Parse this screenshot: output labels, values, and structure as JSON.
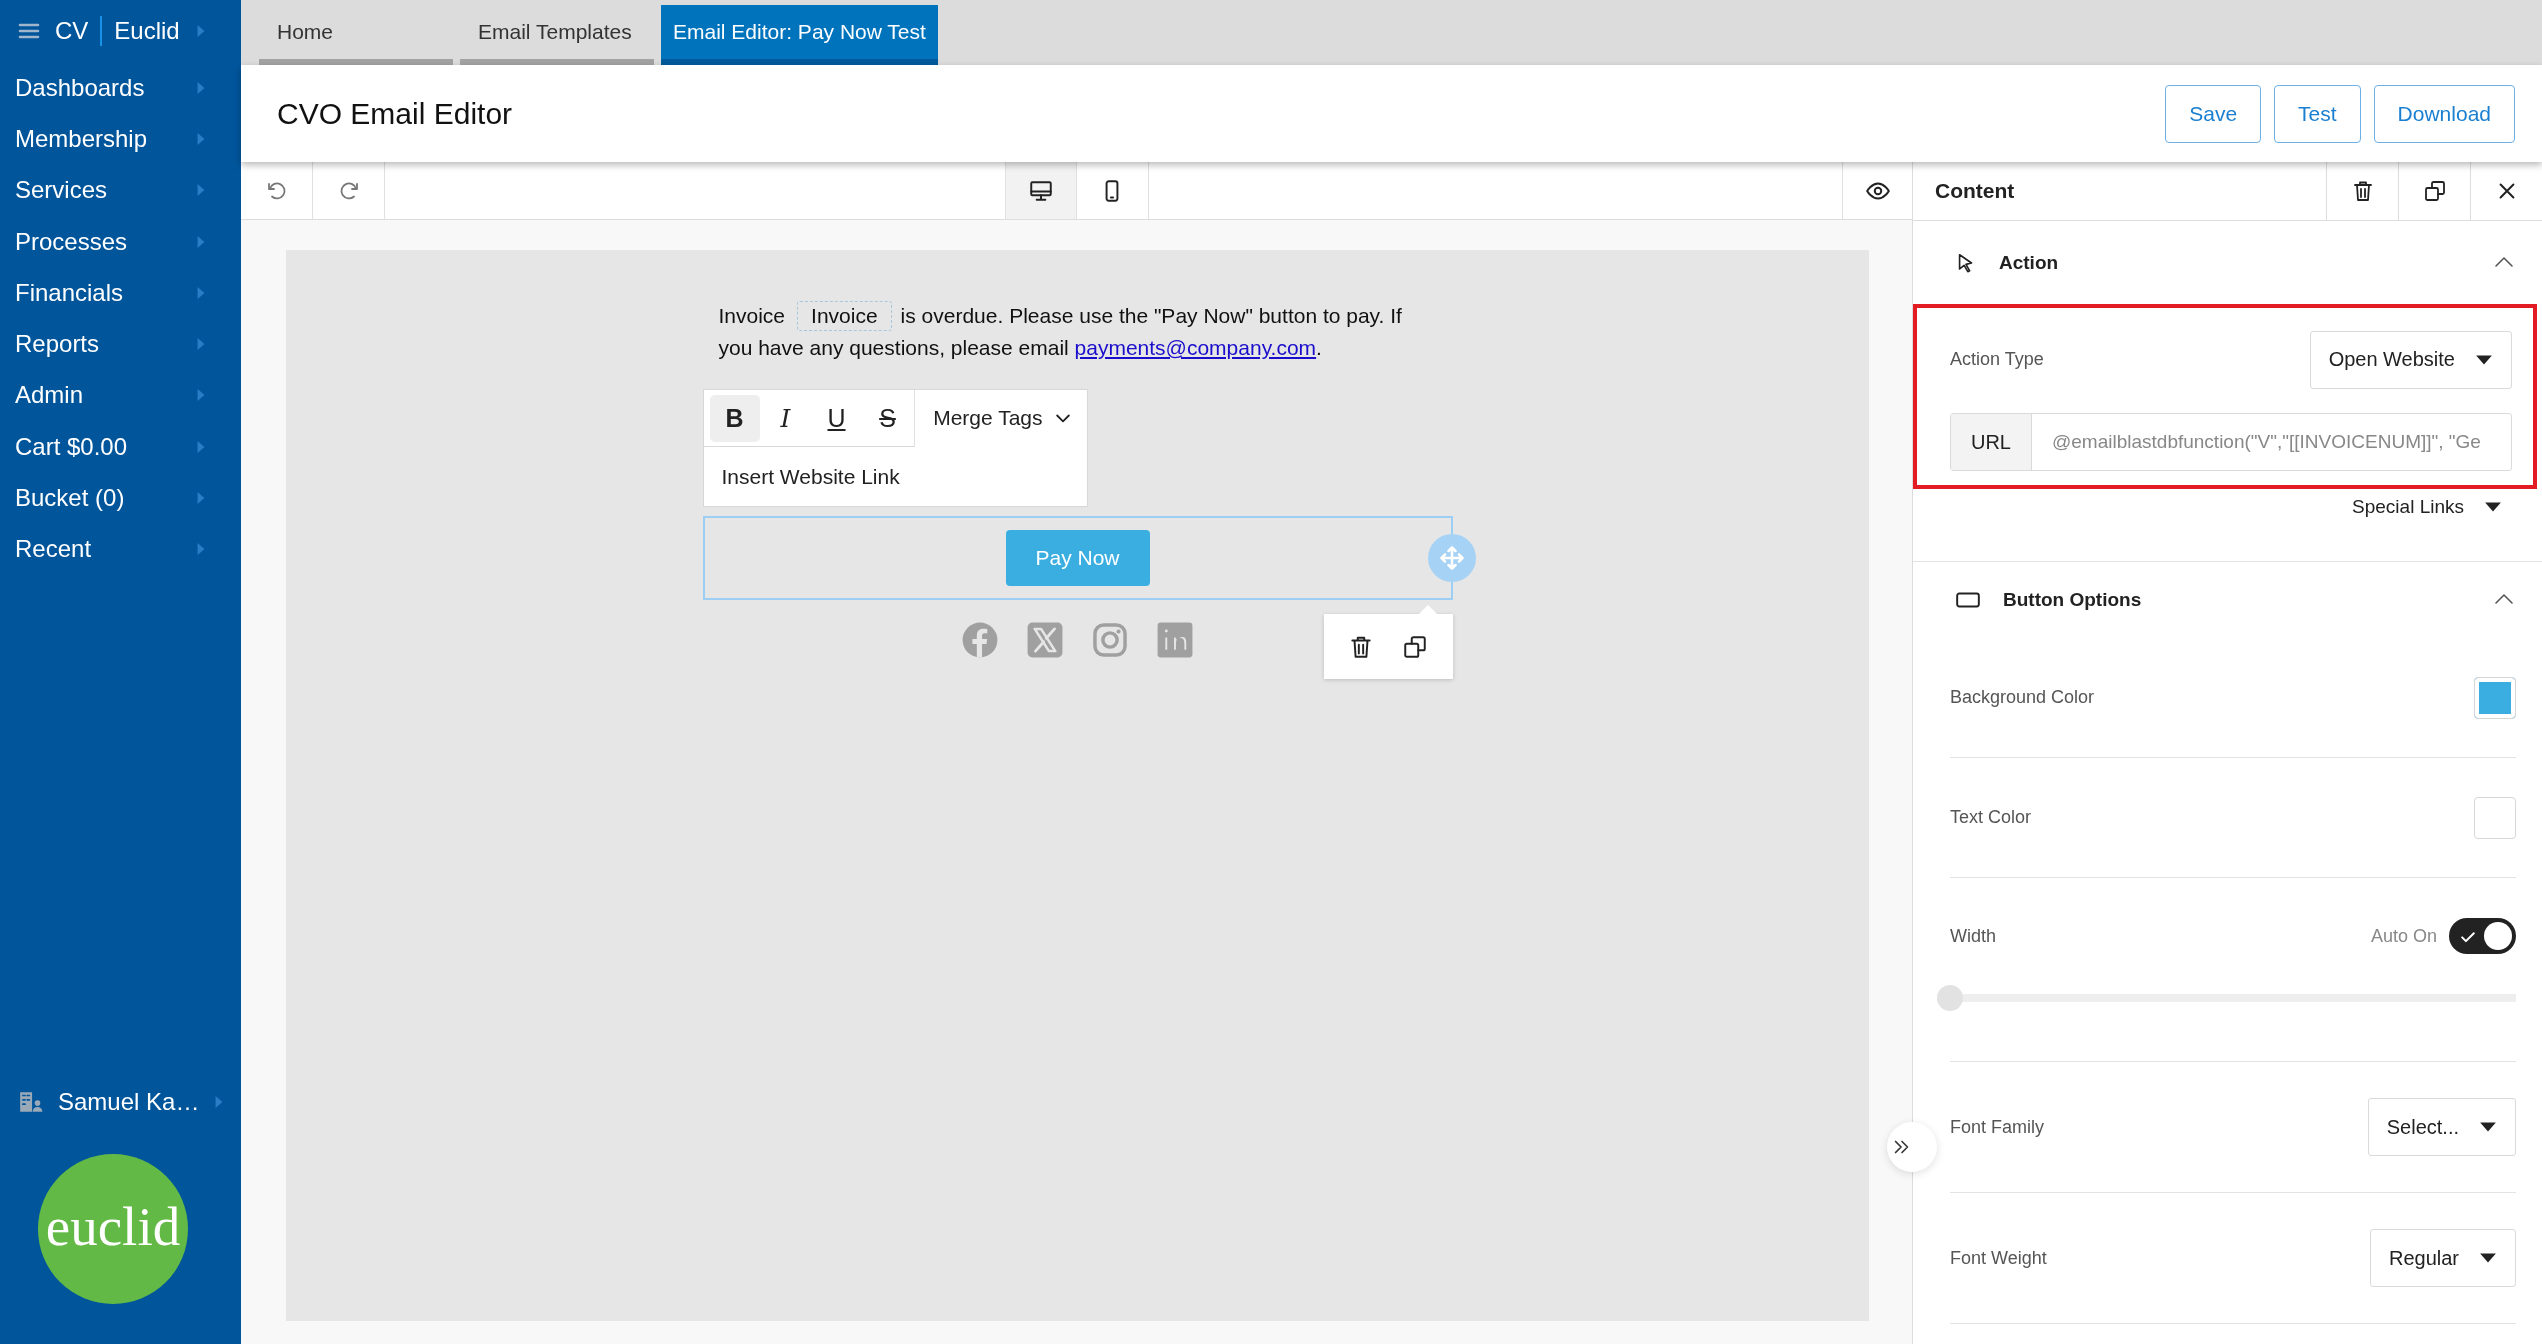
{
  "sidebar": {
    "brand": "CV",
    "product": "Euclid",
    "items": [
      {
        "label": "Dashboards"
      },
      {
        "label": "Membership"
      },
      {
        "label": "Services"
      },
      {
        "label": "Processes"
      },
      {
        "label": "Financials"
      },
      {
        "label": "Reports"
      },
      {
        "label": "Admin"
      },
      {
        "label": "Cart $0.00"
      },
      {
        "label": "Bucket (0)"
      },
      {
        "label": "Recent"
      }
    ],
    "user": "Samuel Ka…",
    "logo": "euclid"
  },
  "tabs": [
    {
      "label": "Home",
      "selected": false
    },
    {
      "label": "Email Templates",
      "selected": false
    },
    {
      "label": "Email Editor: Pay Now Test",
      "selected": true
    }
  ],
  "header": {
    "title": "CVO Email Editor",
    "buttons": [
      "Save",
      "Test",
      "Download"
    ]
  },
  "toolbar": {
    "view_modes": [
      {
        "kind": "desktop",
        "selected": true
      },
      {
        "kind": "mobile",
        "selected": false
      }
    ]
  },
  "email": {
    "text_before": "Invoice",
    "merge_tag": "Invoice",
    "text_after": "is overdue. Please use the \"Pay Now\" button to pay. If you have any questions, please email",
    "link": "payments@company.com",
    "text_end": ".",
    "text_toolbar": {
      "formats": [
        {
          "kind": "bold",
          "label": "B",
          "selected": true
        },
        {
          "kind": "italic",
          "label": "I",
          "selected": false
        },
        {
          "kind": "underline",
          "label": "U",
          "selected": false
        },
        {
          "kind": "strike",
          "label": "S",
          "selected": false
        }
      ],
      "merge_tags": "Merge Tags",
      "link_placeholder": "Insert Website Link"
    },
    "button": {
      "label": "Pay Now",
      "selected": true
    },
    "social": [
      {
        "kind": "facebook"
      },
      {
        "kind": "x"
      },
      {
        "kind": "instagram"
      },
      {
        "kind": "linkedin"
      }
    ]
  },
  "panel": {
    "title": "Content",
    "action": {
      "title": "Action",
      "expanded": true,
      "highlighted": true,
      "type_label": "Action Type",
      "type_value": "Open Website",
      "url_label": "URL",
      "url_value": "@emailblastdbfunction(\"V\",\"[[INVOICENUM]]\", \"Ge",
      "special_links": "Special Links"
    },
    "button_options": {
      "title": "Button Options",
      "expanded": true,
      "rows": [
        {
          "kind": "color",
          "label": "Background Color",
          "color": "#3aaee0"
        },
        {
          "kind": "color",
          "label": "Text Color",
          "color": "#ffffff"
        },
        {
          "kind": "width",
          "label": "Width",
          "auto_label": "Auto On",
          "on": true,
          "level": 0
        },
        {
          "kind": "select",
          "label": "Font Family",
          "value": "Select..."
        },
        {
          "kind": "select",
          "label": "Font Weight",
          "value": "Regular"
        }
      ]
    }
  }
}
